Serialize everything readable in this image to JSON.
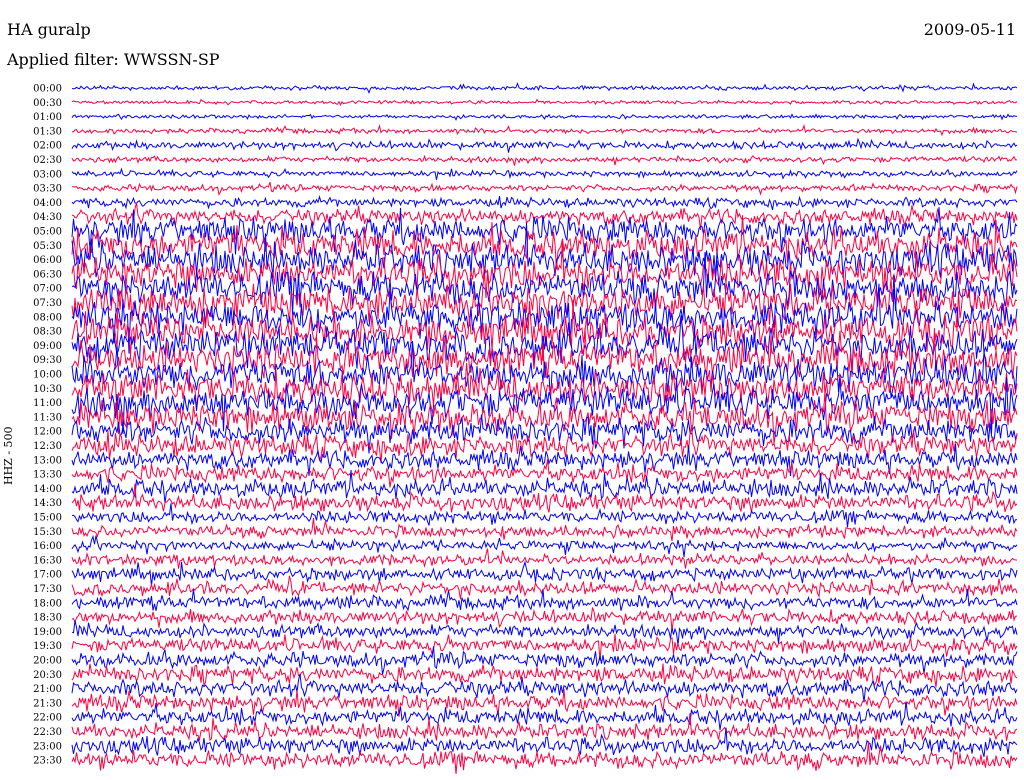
{
  "header": {
    "station": "HA guralp",
    "date": "2009-05-11",
    "filter_text": "Applied filter: WWSSN-SP"
  },
  "chart_data": {
    "type": "line",
    "subtype": "helicorder",
    "channel_label": "HHZ - 500",
    "row_labels": [
      "00:00",
      "00:30",
      "01:00",
      "01:30",
      "02:00",
      "02:30",
      "03:00",
      "03:30",
      "04:00",
      "04:30",
      "05:00",
      "05:30",
      "06:00",
      "06:30",
      "07:00",
      "07:30",
      "08:00",
      "08:30",
      "09:00",
      "09:30",
      "10:00",
      "10:30",
      "11:00",
      "11:30",
      "12:00",
      "12:30",
      "13:00",
      "13:30",
      "14:00",
      "14:30",
      "15:00",
      "15:30",
      "16:00",
      "16:30",
      "17:00",
      "17:30",
      "18:00",
      "18:30",
      "19:00",
      "19:30",
      "20:00",
      "20:30",
      "21:00",
      "21:30",
      "22:00",
      "22:30",
      "23:00",
      "23:30"
    ],
    "row_minutes": 30,
    "relative_amplitude": [
      0.25,
      0.2,
      0.22,
      0.3,
      0.45,
      0.35,
      0.35,
      0.4,
      0.55,
      0.9,
      1.6,
      1.8,
      1.9,
      1.9,
      1.9,
      1.9,
      1.9,
      1.9,
      1.9,
      1.9,
      1.9,
      1.9,
      1.8,
      1.7,
      1.5,
      1.3,
      1.1,
      1.0,
      1.1,
      1.0,
      0.75,
      0.7,
      0.6,
      0.65,
      0.75,
      0.8,
      0.8,
      0.8,
      0.8,
      0.85,
      0.9,
      0.95,
      0.95,
      0.95,
      0.95,
      0.95,
      1.0,
      1.0
    ],
    "colors": {
      "even_rows": "#0000ff",
      "odd_rows": "#ff0040"
    }
  }
}
